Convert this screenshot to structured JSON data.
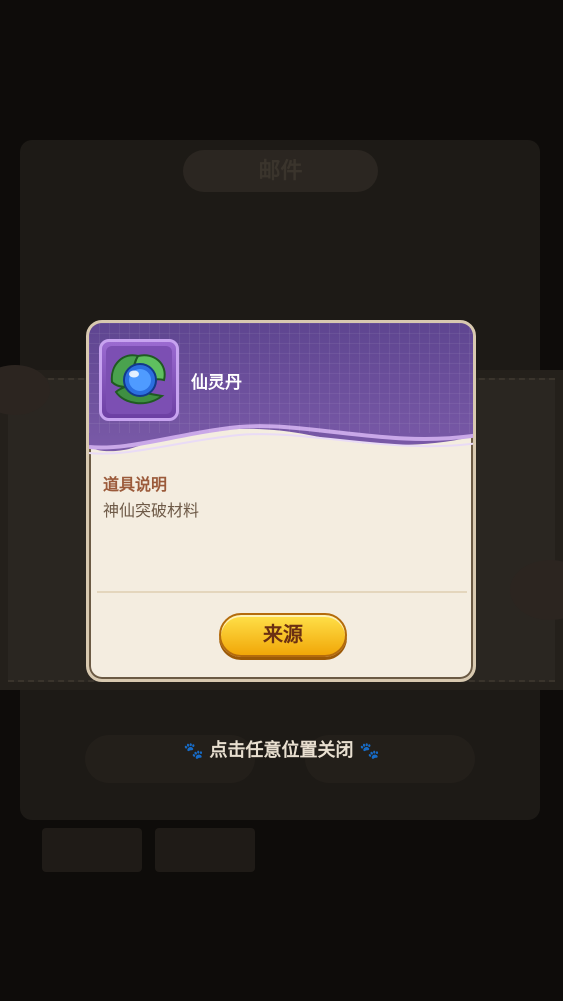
{
  "background": {
    "title": "邮件",
    "subtitle": "",
    "left_button": "",
    "right_button": "",
    "tabs": [
      "",
      ""
    ]
  },
  "popup": {
    "item_name": "仙灵丹",
    "item_icon": "blue-pill-on-leaf-icon",
    "description_title": "道具说明",
    "description_text": "神仙突破材料",
    "source_button_label": "来源"
  },
  "close_hint": "点击任意位置关闭",
  "colors": {
    "header_purple": "#7a5aa8",
    "popup_bg": "#f4ede0",
    "button_yellow": "#fcd233",
    "desc_title": "#9b5a3a"
  }
}
